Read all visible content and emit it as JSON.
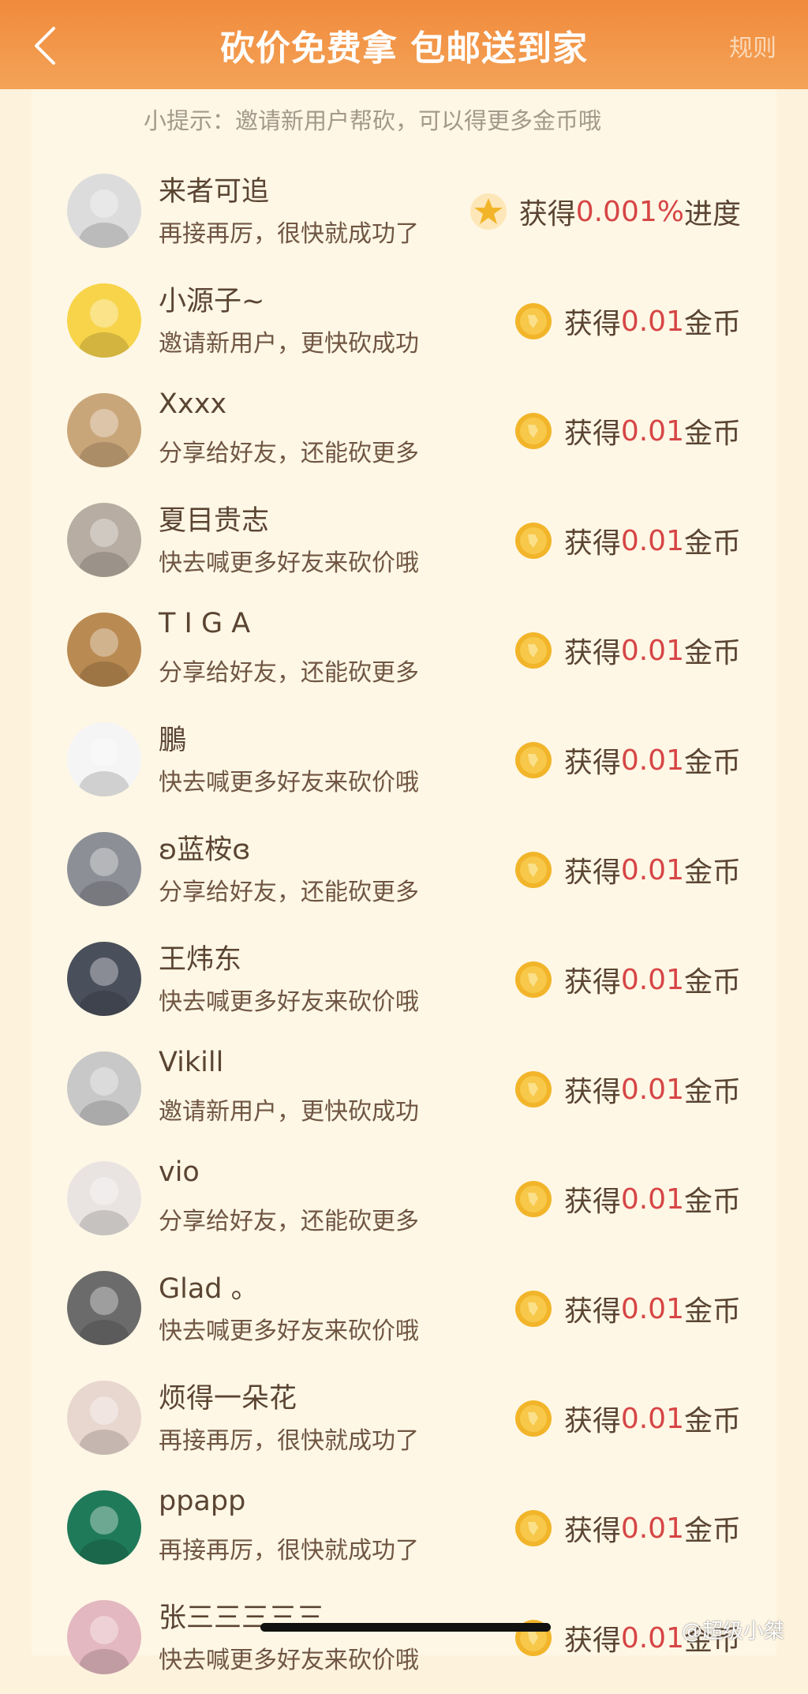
{
  "header": {
    "title": "砍价免费拿 包邮送到家",
    "rules_label": "规则"
  },
  "tip": "小提示：邀请新用户帮砍，可以得更多金币哦",
  "rows": [
    {
      "name": "来者可追",
      "message": "再接再厉，很快就成功了",
      "reward_prefix": "获得",
      "reward_value": "0.001%",
      "reward_suffix": "进度",
      "icon": "star-badge-icon",
      "avatar_color": "#dcdcdc"
    },
    {
      "name": "小源子~",
      "message": "邀请新用户，更快砍成功",
      "reward_prefix": "获得",
      "reward_value": "0.01",
      "reward_suffix": "金币",
      "icon": "gold-coin-icon",
      "avatar_color": "#f7d44a"
    },
    {
      "name": "Xxxx",
      "message": "分享给好友，还能砍更多",
      "reward_prefix": "获得",
      "reward_value": "0.01",
      "reward_suffix": "金币",
      "icon": "gold-coin-icon",
      "avatar_color": "#c9a67a"
    },
    {
      "name": "夏目贵志",
      "message": "快去喊更多好友来砍价哦",
      "reward_prefix": "获得",
      "reward_value": "0.01",
      "reward_suffix": "金币",
      "icon": "gold-coin-icon",
      "avatar_color": "#b7ada2"
    },
    {
      "name": "T I G A",
      "message": "分享给好友，还能砍更多",
      "reward_prefix": "获得",
      "reward_value": "0.01",
      "reward_suffix": "金币",
      "icon": "gold-coin-icon",
      "avatar_color": "#b98a52"
    },
    {
      "name": "鵬",
      "message": "快去喊更多好友来砍价哦",
      "reward_prefix": "获得",
      "reward_value": "0.01",
      "reward_suffix": "金币",
      "icon": "gold-coin-icon",
      "avatar_color": "#f5f5f5"
    },
    {
      "name": "ʚ蓝桉ɞ",
      "message": "分享给好友，还能砍更多",
      "reward_prefix": "获得",
      "reward_value": "0.01",
      "reward_suffix": "金币",
      "icon": "gold-coin-icon",
      "avatar_color": "#8c8f96"
    },
    {
      "name": "王炜东",
      "message": "快去喊更多好友来砍价哦",
      "reward_prefix": "获得",
      "reward_value": "0.01",
      "reward_suffix": "金币",
      "icon": "gold-coin-icon",
      "avatar_color": "#4a4f5c"
    },
    {
      "name": "Vikill",
      "message": "邀请新用户，更快砍成功",
      "reward_prefix": "获得",
      "reward_value": "0.01",
      "reward_suffix": "金币",
      "icon": "gold-coin-icon",
      "avatar_color": "#c8c8c8"
    },
    {
      "name": "vio",
      "message": "分享给好友，还能砍更多",
      "reward_prefix": "获得",
      "reward_value": "0.01",
      "reward_suffix": "金币",
      "icon": "gold-coin-icon",
      "avatar_color": "#e9e4e2"
    },
    {
      "name": "Glad 。",
      "message": "快去喊更多好友来砍价哦",
      "reward_prefix": "获得",
      "reward_value": "0.01",
      "reward_suffix": "金币",
      "icon": "gold-coin-icon",
      "avatar_color": "#6b6b6b"
    },
    {
      "name": "烦得一朵花",
      "message": "再接再厉，很快就成功了",
      "reward_prefix": "获得",
      "reward_value": "0.01",
      "reward_suffix": "金币",
      "icon": "gold-coin-icon",
      "avatar_color": "#e8d7cf"
    },
    {
      "name": "ppapp",
      "message": "再接再厉，很快就成功了",
      "reward_prefix": "获得",
      "reward_value": "0.01",
      "reward_suffix": "金币",
      "icon": "gold-coin-icon",
      "avatar_color": "#1f7a5a"
    },
    {
      "name": "张三三三三三",
      "message": "快去喊更多好友来砍价哦",
      "reward_prefix": "获得",
      "reward_value": "0.01",
      "reward_suffix": "金币",
      "icon": "gold-coin-icon",
      "avatar_color": "#e3b8c0"
    }
  ],
  "watermark": "@超级小桀",
  "colors": {
    "header_top": "#f08a3c",
    "header_bottom": "#f4a357",
    "page_bg": "#fdf2dc",
    "panel_bg": "#fff7e5",
    "reward_value": "#d64545",
    "coin": "#f2b52a"
  }
}
